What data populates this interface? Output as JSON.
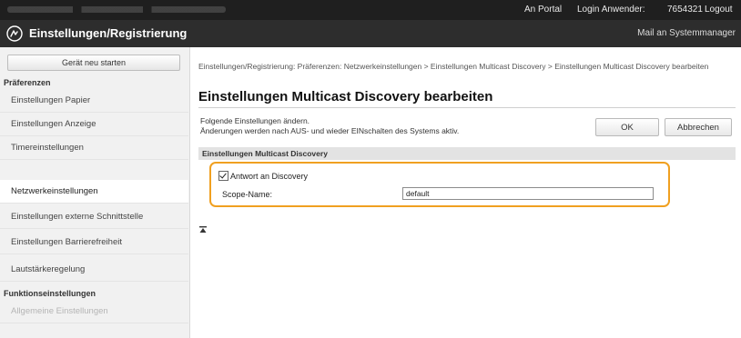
{
  "topbar": {
    "portal": "An Portal",
    "login_label": "Login Anwender:",
    "user_id": "7654321",
    "logout": "Logout"
  },
  "header": {
    "logo_icon": "settings-registration-icon",
    "title": "Einstellungen/Registrierung",
    "mail_link": "Mail an Systemmanager"
  },
  "sidebar": {
    "restart_button": "Gerät neu starten",
    "preferences_heading": "Präferenzen",
    "items": [
      {
        "label": "Einstellungen Papier"
      },
      {
        "label": "Einstellungen Anzeige"
      },
      {
        "label": "Timereinstellungen"
      },
      {
        "label": "Netzwerkeinstellungen"
      },
      {
        "label": "Einstellungen externe Schnittstelle"
      },
      {
        "label": "Einstellungen Barrierefreiheit"
      },
      {
        "label": "Lautstärkeregelung"
      }
    ],
    "functions_heading": "Funktionseinstellungen",
    "functions_items": [
      {
        "label": "Allgemeine Einstellungen"
      }
    ]
  },
  "main": {
    "breadcrumb": "Einstellungen/Registrierung: Präferenzen: Netzwerkeinstellungen > Einstellungen Multicast Discovery > Einstellungen Multicast Discovery bearbeiten",
    "title": "Einstellungen Multicast Discovery bearbeiten",
    "desc_line1": "Folgende Einstellungen ändern.",
    "desc_line2": "Änderungen werden nach AUS- und wieder EINschalten des Systems aktiv.",
    "ok_label": "OK",
    "cancel_label": "Abbrechen",
    "section_title": "Einstellungen Multicast Discovery",
    "checkbox_label": "Antwort an Discovery",
    "scope_label": "Scope-Name:",
    "scope_value": "default",
    "top_icon": "back-to-top-icon"
  },
  "colors": {
    "highlight": "#f0a020",
    "topbar": "#1f1f1f",
    "titlebar": "#2d2d2d"
  }
}
